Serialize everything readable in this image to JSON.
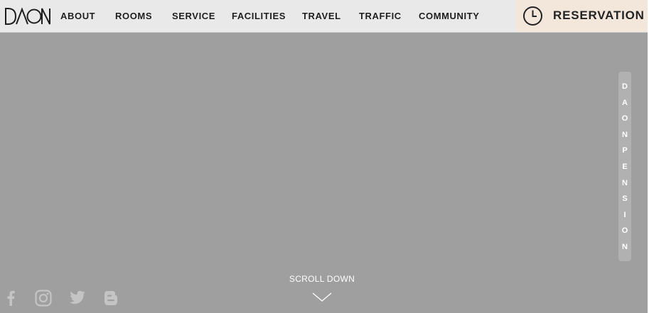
{
  "brand": {
    "logo_text": "DAON"
  },
  "nav": {
    "items": [
      {
        "label": "ABOUT"
      },
      {
        "label": "ROOMS"
      },
      {
        "label": "SERVICE"
      },
      {
        "label": "FACILITIES"
      },
      {
        "label": "TRAVEL"
      },
      {
        "label": "TRAFFIC"
      },
      {
        "label": "COMMUNITY"
      }
    ]
  },
  "reservation": {
    "label": "RESERVATION",
    "icon": "clock-icon"
  },
  "side_tab": {
    "letters": [
      "D",
      "A",
      "O",
      "N",
      "P",
      "E",
      "N",
      "S",
      "I",
      "O",
      "N"
    ]
  },
  "scroll": {
    "label": "SCROLL DOWN",
    "icon": "chevron-down-icon"
  },
  "social": {
    "icons": [
      "facebook-icon",
      "instagram-icon",
      "twitter-icon",
      "blog-icon"
    ]
  },
  "colors": {
    "hero_background": "#9f9f9f",
    "header_background": "#e9e9e9",
    "reservation_background": "#f3e6da",
    "side_tab_background": "#b1b1b1",
    "text_dark": "#1f1f1f"
  }
}
